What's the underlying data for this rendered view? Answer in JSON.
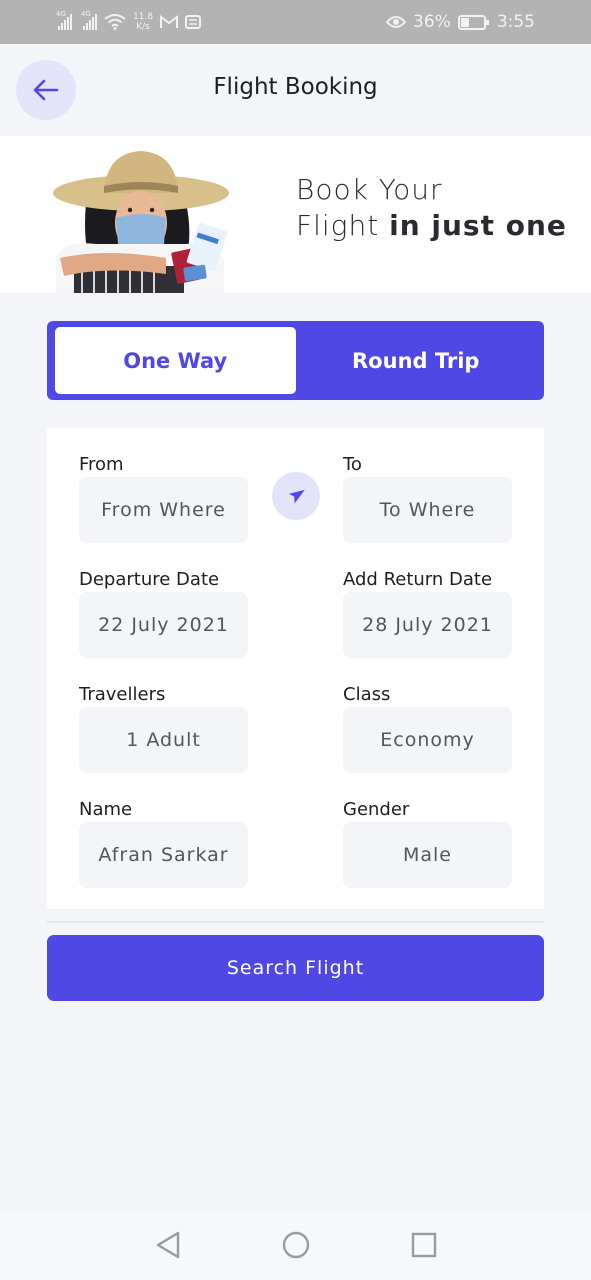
{
  "status_bar": {
    "net1": "4G",
    "net2": "4G",
    "speed": "11.8",
    "speed_unit": "K/s",
    "battery_percent": "36%",
    "battery_level": 0.36,
    "time": "3:55",
    "icons": [
      "signal-icon",
      "signal-icon",
      "wifi-icon",
      "gmail-icon",
      "notification-icon",
      "eye-icon",
      "battery-icon"
    ]
  },
  "header": {
    "title": "Flight Booking",
    "back_icon": "arrow-left-icon"
  },
  "banner": {
    "line1": "Book Your",
    "line2_plain": "Flight",
    "line2_bold": "in just one"
  },
  "trip_toggle": {
    "one_way": "One Way",
    "round_trip": "Round Trip",
    "selected": "One Way"
  },
  "form": {
    "from_label": "From",
    "from_value": "From Where",
    "to_label": "To",
    "to_value": "To Where",
    "swap_icon": "airplane-icon",
    "departure_label": "Departure Date",
    "departure_value": "22 July 2021",
    "return_label": "Add Return Date",
    "return_value": "28 July 2021",
    "travellers_label": "Travellers",
    "travellers_value": "1 Adult",
    "class_label": "Class",
    "class_value": "Economy",
    "name_label": "Name",
    "name_value": "Afran Sarkar",
    "gender_label": "Gender",
    "gender_value": "Male"
  },
  "search_button": "Search Flight",
  "nav_bar": [
    "back-triangle-icon",
    "home-circle-icon",
    "recents-square-icon"
  ],
  "colors": {
    "accent": "#5048e5",
    "accent_light": "#e3e4f9",
    "background": "#f3f5f8",
    "status_bar": "#b3b3b3"
  }
}
